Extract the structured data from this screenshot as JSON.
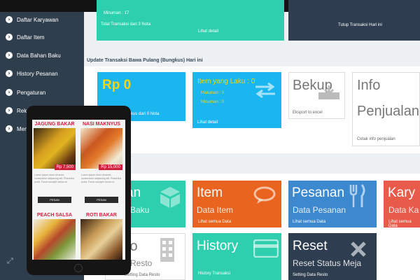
{
  "sidebar": {
    "items": [
      {
        "label": "Daftar Karyawan"
      },
      {
        "label": "Daftar Item"
      },
      {
        "label": "Data Bahan Baku"
      },
      {
        "label": "History Pesanan"
      },
      {
        "label": "Pengaturan"
      },
      {
        "label": "Rekap"
      },
      {
        "label": "Menu"
      }
    ]
  },
  "top_tiles": {
    "green_line1": "Minuman : 17",
    "green_line2": "Total Transaksi dari 3 Nota",
    "green_link": "Lihat detail",
    "dark_label": "Tutup Transaksi Hari ini"
  },
  "section_title": "Update Transaksi Bawa Pulang (Bungkus) Hari ini",
  "row2": {
    "rp_value": "Rp 0",
    "rp_caption": "Bungkus dari 0 Nota",
    "laku_title": "Item yang Laku : 0",
    "laku_makanan": "Makanan : 0",
    "laku_minuman": "Minuman : 0",
    "laku_link": "Lihat detail",
    "bekup_title": "Bekup",
    "bekup_foot": "Eksport to excel",
    "info_title1": "Info",
    "info_title2": "Penjualan",
    "info_foot": "Cetak info penjualan"
  },
  "row3": [
    {
      "title": "Item",
      "sub": "Data Item",
      "foot": "Lihat semua Data",
      "color": "#e8641f"
    },
    {
      "title": "Pesanan",
      "sub": "Data Pesanan",
      "foot": "Lihat semua Data",
      "color": "#3d89cf"
    },
    {
      "title": "Kary",
      "sub": "Data Ka",
      "foot": "Lihat semua Data",
      "color": "#e85a4a"
    }
  ],
  "row3_left": {
    "title": "an",
    "sub": "Baku",
    "color": "#2ecfae"
  },
  "row4": [
    {
      "title": "History",
      "foot": "History Transaksi",
      "color": "#2ecfae"
    },
    {
      "title": "Reset",
      "sub": "Reset Status Meja",
      "foot": "Setting Data Resto",
      "color": "#2e3e50"
    }
  ],
  "row4_left": {
    "title": "to",
    "sub": "Resto",
    "foot": "Setting Data Resto"
  },
  "tablet_menu": [
    {
      "name": "JAGUNG BAKAR",
      "price": "Rp 7,500",
      "desc": "Lorem ipsum dolor sit amet, consectetur adipiscing elit. Phasellus porta. Fusce suscipit varius mi.",
      "btn": "PESAN"
    },
    {
      "name": "NASI MAKNYUS",
      "price": "Rp 15,000",
      "desc": "Lorem ipsum dolor sit amet, consectetur adipiscing elit. Phasellus porta. Fusce suscipit varius mi.",
      "btn": "PESAN"
    },
    {
      "name": "PEACH SALSA"
    },
    {
      "name": "ROTI BAKAR"
    }
  ],
  "colors": {
    "sidebar": "#2f3e4d",
    "green": "#2ecfae",
    "blue": "#1ab6f0",
    "orange": "#e8641f",
    "dark": "#2e3e50",
    "accent_red": "#d01f3c"
  },
  "icons": {
    "nav": "chevron-right-circle-icon",
    "laku": "swap-arrows-icon",
    "bekup": "download-icon",
    "bahan": "boxes-icon",
    "item": "chat-bubble-icon",
    "pesanan": "utensils-icon",
    "resto": "building-icon",
    "history": "credit-card-icon",
    "reset": "close-icon"
  }
}
